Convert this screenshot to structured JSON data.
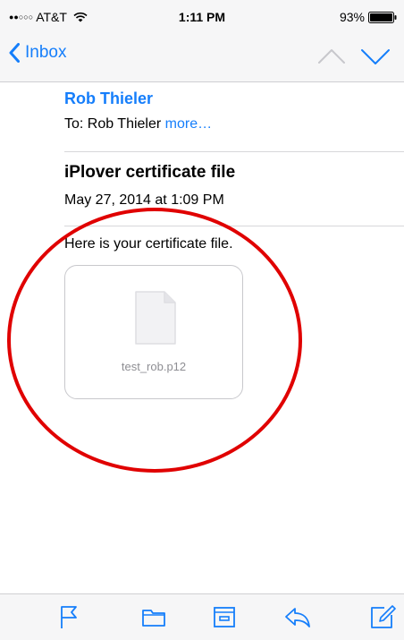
{
  "status_bar": {
    "carrier": "AT&T",
    "signal_dots": "●●○○○",
    "time": "1:11 PM",
    "battery_percent": "93%"
  },
  "nav": {
    "back_label": "Inbox",
    "icons": [
      "chevron-left-icon",
      "chevron-up-icon",
      "chevron-down-icon"
    ]
  },
  "message": {
    "sender": "Rob Thieler",
    "to_prefix": "To:",
    "recipient": "Rob Thieler",
    "more_label": "more…",
    "subject": "iPlover certificate file",
    "date": "May 27, 2014 at 1:09 PM",
    "body": "Here is your certificate file.",
    "attachment": {
      "filename": "test_rob.p12",
      "icon": "document-icon"
    }
  },
  "toolbar": {
    "icons": [
      "flag-icon",
      "folder-icon",
      "archive-icon",
      "reply-icon",
      "compose-icon"
    ]
  },
  "colors": {
    "ios_blue": "#157efb",
    "annotation_red": "#e00000",
    "bar_background": "#f6f6f7",
    "separator": "#d7d7da"
  }
}
